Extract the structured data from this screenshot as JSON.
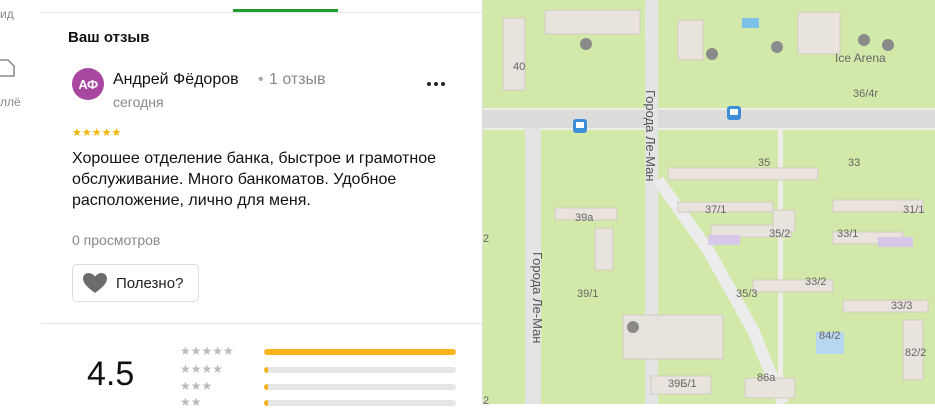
{
  "left_strip": {
    "text_top": "ид",
    "text_mid": "ллё"
  },
  "review_section": {
    "title": "Ваш отзыв",
    "avatar_initials": "АФ",
    "author_name": "Андрей Фёдоров",
    "separator": "•",
    "author_reviews_count": "1 отзыв",
    "date": "сегодня",
    "rating_stars": "★★★★★",
    "rating": 5,
    "text": "Хорошее отделение банка, быстрое и грамотное обслуживание. Много банкоматов. Удобное расположение, лично для меня.",
    "views": "0 просмотров",
    "helpful_label": "Полезно?"
  },
  "rating_summary": {
    "average": "4.5",
    "distribution": [
      {
        "stars": "★★★★★",
        "fraction": 1.0
      },
      {
        "stars": "★★★★",
        "fraction": 0.02
      },
      {
        "stars": "★★★",
        "fraction": 0.02
      },
      {
        "stars": "★★",
        "fraction": 0.02
      }
    ]
  },
  "map": {
    "street_labels": [
      "Города Ле-Ман",
      "Города Ле-Ман"
    ],
    "place_labels": [
      "Ice Arena"
    ],
    "house_numbers": [
      "40",
      "36/4г",
      "35",
      "33",
      "37/1",
      "31/1",
      "39а",
      "35/2",
      "33/1",
      "2",
      "39/1",
      "35/3",
      "33/2",
      "33/3",
      "84/2",
      "82/2",
      "39Б/1",
      "86а",
      "2"
    ],
    "colors": {
      "green": "#d3e9a9",
      "road": "#d9d9d9",
      "building": "#e8e3dc"
    }
  }
}
